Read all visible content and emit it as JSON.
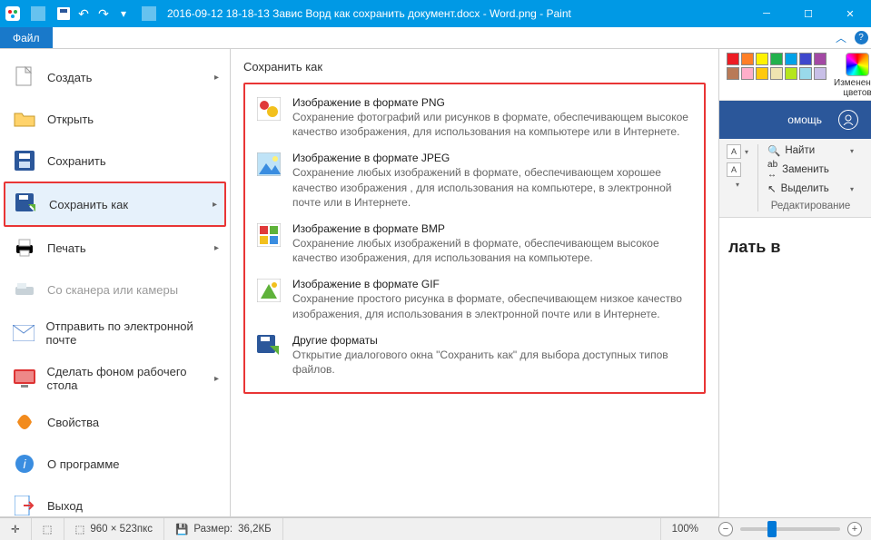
{
  "titlebar": {
    "title": "2016-09-12 18-18-13 Завис Ворд как сохранить документ.docx - Word.png - Paint"
  },
  "filetab": "Файл",
  "menu": {
    "new": "Создать",
    "open": "Открыть",
    "save": "Сохранить",
    "saveas": "Сохранить как",
    "print": "Печать",
    "scanner": "Со сканера или камеры",
    "email": "Отправить по электронной почте",
    "desktop": "Сделать фоном рабочего стола",
    "properties": "Свойства",
    "about": "О программе",
    "exit": "Выход"
  },
  "submenu": {
    "title": "Сохранить как",
    "png": {
      "t": "Изображение в формате PNG",
      "d": "Сохранение фотографий или рисунков в формате, обеспечивающем высокое качество изображения, для использования на компьютере или в Интернете."
    },
    "jpeg": {
      "t": "Изображение в формате JPEG",
      "d": "Сохранение любых изображений в формате, обеспечивающем хорошее качество изображения , для использования на компьютере, в электронной почте или в Интернете."
    },
    "bmp": {
      "t": "Изображение в формате BMP",
      "d": "Сохранение любых изображений в формате, обеспечивающем высокое качество изображения, для использования на компьютере."
    },
    "gif": {
      "t": "Изображение в формате GIF",
      "d": "Сохранение простого рисунка в формате, обеспечивающем низкое качество изображения, для использования в электронной почте или в Интернете."
    },
    "other": {
      "t": "Другие форматы",
      "d": "Открытие диалогового окна \"Сохранить как\" для выбора доступных типов файлов."
    }
  },
  "palette": {
    "row1": [
      "#ed1c24",
      "#ff7f27",
      "#fff200",
      "#22b14c",
      "#00a2e8",
      "#3f48cc",
      "#a349a4"
    ],
    "row2": [
      "#b97a57",
      "#ffaec9",
      "#ffc90e",
      "#efe4b0",
      "#b5e61d",
      "#99d9ea",
      "#c8bfe7"
    ],
    "label": "Изменение цветов"
  },
  "word": {
    "help": "омощь",
    "find": "Найти",
    "replace": "Заменить",
    "select": "Выделить",
    "group": "Редактирование",
    "doc_text": "лать в"
  },
  "status": {
    "dims": "960 × 523пкс",
    "size_label": "Размер:",
    "size_val": "36,2КБ",
    "zoom": "100%"
  }
}
